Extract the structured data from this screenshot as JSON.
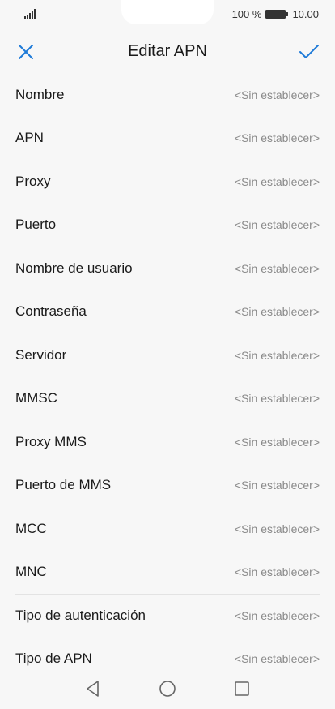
{
  "status": {
    "battery_text": "100 %",
    "time": "10.00"
  },
  "header": {
    "title": "Editar APN",
    "close_icon": "close-icon",
    "confirm_icon": "check-icon"
  },
  "fields": [
    {
      "label": "Nombre",
      "value": "<Sin establecer>"
    },
    {
      "label": "APN",
      "value": "<Sin establecer>"
    },
    {
      "label": "Proxy",
      "value": "<Sin establecer>"
    },
    {
      "label": "Puerto",
      "value": "<Sin establecer>"
    },
    {
      "label": "Nombre de usuario",
      "value": "<Sin establecer>"
    },
    {
      "label": "Contraseña",
      "value": "<Sin establecer>"
    },
    {
      "label": "Servidor",
      "value": "<Sin establecer>"
    },
    {
      "label": "MMSC",
      "value": "<Sin establecer>"
    },
    {
      "label": "Proxy MMS",
      "value": "<Sin establecer>"
    },
    {
      "label": "Puerto de MMS",
      "value": "<Sin establecer>"
    },
    {
      "label": "MCC",
      "value": "<Sin establecer>"
    },
    {
      "label": "MNC",
      "value": "<Sin establecer>"
    },
    {
      "label": "Tipo de autenticación",
      "value": "<Sin establecer>"
    },
    {
      "label": "Tipo de APN",
      "value": "<Sin establecer>"
    }
  ],
  "colors": {
    "accent": "#1e7ad8",
    "background": "#f7f7f7",
    "value_text": "#8a8a8a"
  },
  "nav": {
    "back_icon": "back-triangle-icon",
    "home_icon": "home-circle-icon",
    "recent_icon": "recents-square-icon"
  }
}
